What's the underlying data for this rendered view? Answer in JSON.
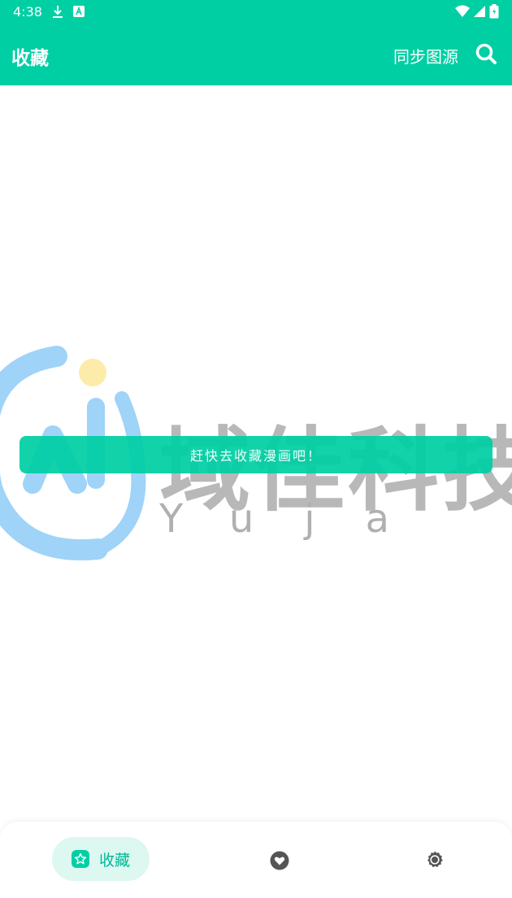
{
  "status_bar": {
    "time": "4:38"
  },
  "app_bar": {
    "title": "收藏",
    "sync_label": "同步图源"
  },
  "main": {
    "empty_message": "赶快去收藏漫画吧！"
  },
  "watermark": {
    "chars": "域佳科技",
    "latin": "Yuja"
  },
  "bottom_nav": {
    "favorites_label": "收藏"
  },
  "colors": {
    "primary": "#00CFA4",
    "nav_pill": "#DDF7F1",
    "icon_gray": "#555555"
  }
}
